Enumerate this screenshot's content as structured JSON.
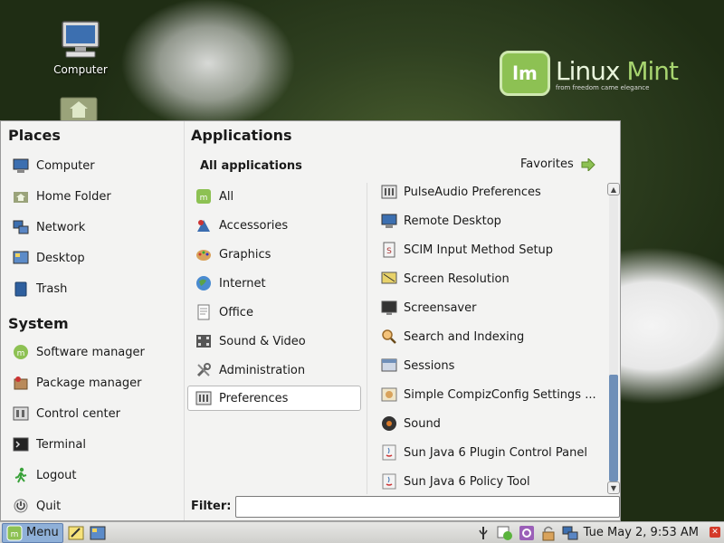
{
  "desktop": {
    "icons": [
      {
        "label": "Computer",
        "icon": "computer-icon"
      },
      {
        "label": "",
        "icon": "home-folder-icon"
      }
    ],
    "logo": {
      "name_part1": "Linux",
      "name_part2": "Mint",
      "tagline": "from freedom came elegance",
      "mark": "lm"
    }
  },
  "menu": {
    "places_title": "Places",
    "places": [
      {
        "label": "Computer",
        "icon": "computer-icon"
      },
      {
        "label": "Home Folder",
        "icon": "home-folder-icon"
      },
      {
        "label": "Network",
        "icon": "network-icon"
      },
      {
        "label": "Desktop",
        "icon": "desktop-icon"
      },
      {
        "label": "Trash",
        "icon": "trash-icon"
      }
    ],
    "system_title": "System",
    "system": [
      {
        "label": "Software manager",
        "icon": "software-manager-icon"
      },
      {
        "label": "Package manager",
        "icon": "package-manager-icon"
      },
      {
        "label": "Control center",
        "icon": "control-center-icon"
      },
      {
        "label": "Terminal",
        "icon": "terminal-icon"
      },
      {
        "label": "Logout",
        "icon": "logout-icon"
      },
      {
        "label": "Quit",
        "icon": "quit-icon"
      }
    ],
    "applications_title": "Applications",
    "all_applications_label": "All applications",
    "favorites_label": "Favorites",
    "categories": [
      {
        "label": "All",
        "icon": "all-apps-icon"
      },
      {
        "label": "Accessories",
        "icon": "accessories-icon"
      },
      {
        "label": "Graphics",
        "icon": "graphics-icon"
      },
      {
        "label": "Internet",
        "icon": "internet-icon"
      },
      {
        "label": "Office",
        "icon": "office-icon"
      },
      {
        "label": "Sound & Video",
        "icon": "sound-video-icon"
      },
      {
        "label": "Administration",
        "icon": "administration-icon"
      },
      {
        "label": "Preferences",
        "icon": "preferences-icon",
        "selected": true
      }
    ],
    "apps": [
      {
        "label": "PulseAudio Preferences",
        "icon": "pulseaudio-icon"
      },
      {
        "label": "Remote Desktop",
        "icon": "remote-desktop-icon"
      },
      {
        "label": "SCIM Input Method Setup",
        "icon": "scim-icon"
      },
      {
        "label": "Screen Resolution",
        "icon": "screen-resolution-icon"
      },
      {
        "label": "Screensaver",
        "icon": "screensaver-icon"
      },
      {
        "label": "Search and Indexing",
        "icon": "search-indexing-icon"
      },
      {
        "label": "Sessions",
        "icon": "sessions-icon"
      },
      {
        "label": "Simple CompizConfig Settings ...",
        "icon": "compizconfig-icon"
      },
      {
        "label": "Sound",
        "icon": "sound-icon"
      },
      {
        "label": "Sun Java 6 Plugin Control Panel",
        "icon": "java-icon"
      },
      {
        "label": "Sun Java 6 Policy Tool",
        "icon": "java-icon"
      }
    ],
    "filter_label": "Filter:",
    "filter_value": "",
    "scroll_position": 0.63
  },
  "taskbar": {
    "menu_label": "Menu",
    "clock": "Tue May  2,  9:53 AM"
  }
}
